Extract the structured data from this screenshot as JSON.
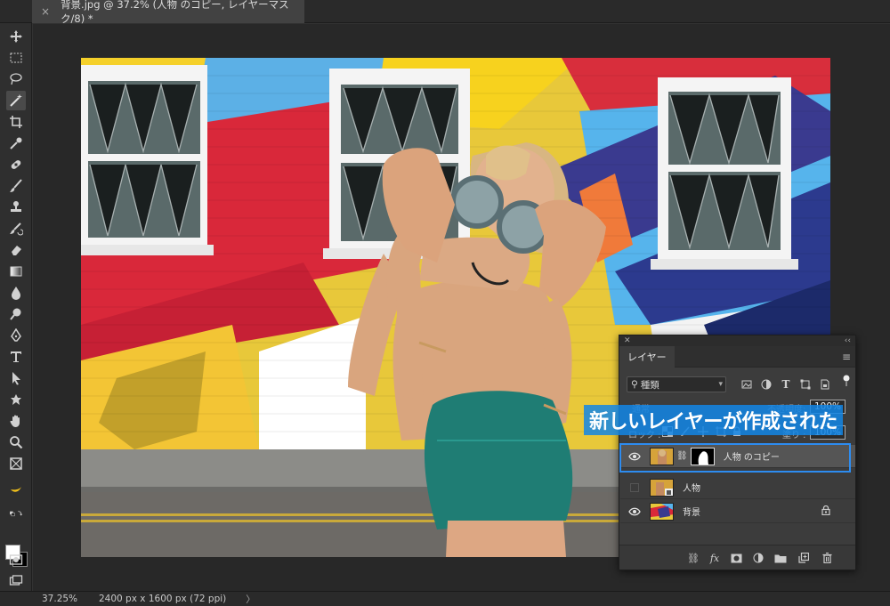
{
  "document_tab": {
    "close_glyph": "×",
    "title": "背景.jpg @ 37.2% (人物 のコピー, レイヤーマスク/8) *"
  },
  "toolbar": {
    "tools": [
      "move",
      "marquee",
      "lasso",
      "magic-wand",
      "crop",
      "eyedropper",
      "healing",
      "brush",
      "clone-stamp",
      "history-brush",
      "eraser",
      "gradient",
      "blur",
      "dodge",
      "pen",
      "type",
      "path-select",
      "shape",
      "hand",
      "zoom",
      "frame"
    ],
    "active_tool": "magic-wand",
    "foreground_color": "#ffffff",
    "background_color": "#000000"
  },
  "status": {
    "zoom": "37.25%",
    "doc_size": "2400 px x 1600 px (72 ppi)",
    "arrow": "〉"
  },
  "layers_panel": {
    "tab_label": "レイヤー",
    "filter_kind": "種類",
    "blend_mode": "通常",
    "opacity_label": "不透明度:",
    "opacity_value": "100%",
    "lock_label": "ロック :",
    "fill_label": "塗り :",
    "fill_value": "100%",
    "layers": [
      {
        "name": "人物 のコピー",
        "visible": true,
        "selected": true,
        "has_mask": true
      },
      {
        "name": "人物",
        "visible": false,
        "selected": false,
        "smart_object": true
      },
      {
        "name": "背景",
        "visible": true,
        "selected": false,
        "locked": true
      }
    ],
    "fx_label": "fx",
    "selection_color": "#2d8cf0"
  },
  "annotation": {
    "text": "新しいレイヤーが作成された",
    "color": "#1286e6"
  }
}
